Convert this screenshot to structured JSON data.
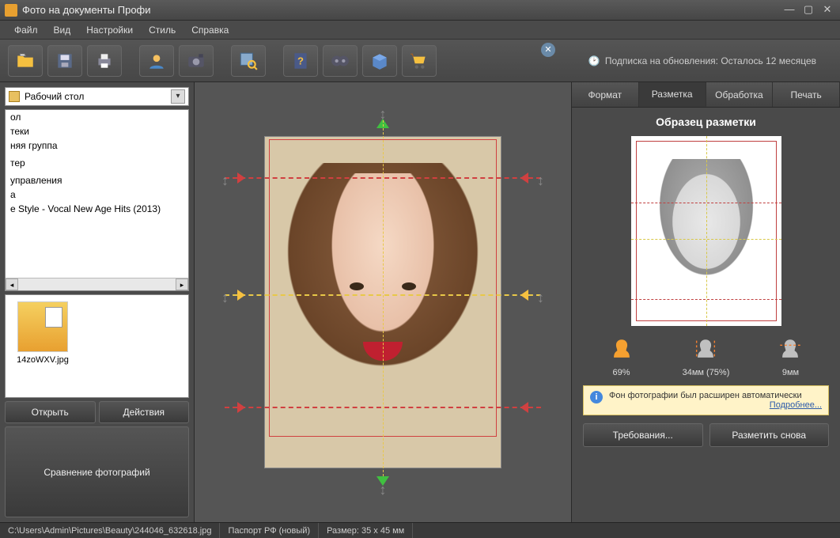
{
  "window": {
    "title": "Фото на документы Профи"
  },
  "menu": [
    "Файл",
    "Вид",
    "Настройки",
    "Стиль",
    "Справка"
  ],
  "subscription": "Подписка на обновления: Осталось 12 месяцев",
  "left": {
    "combo": "Рабочий стол",
    "dirs": [
      "ол",
      "теки",
      "няя группа",
      "",
      "тер",
      "",
      "управления",
      "а",
      "e Style - Vocal New Age Hits (2013)"
    ],
    "thumb_name": "14zoWXV.jpg",
    "btn_open": "Открыть",
    "btn_actions": "Действия",
    "btn_compare": "Сравнение фотографий"
  },
  "tabs": {
    "t1": "Формат",
    "t2": "Разметка",
    "t3": "Обработка",
    "t4": "Печать"
  },
  "right": {
    "sample_title": "Образец разметки",
    "m1": "69%",
    "m2": "34мм (75%)",
    "m3": "9мм",
    "info_text": "Фон фотографии был расширен автоматически",
    "info_more": "Подробнее...",
    "btn_req": "Требования...",
    "btn_remark": "Разметить снова"
  },
  "status": {
    "path": "C:\\Users\\Admin\\Pictures\\Beauty\\244046_632618.jpg",
    "format": "Паспорт РФ (новый)",
    "size": "Размер: 35 x 45 мм"
  }
}
